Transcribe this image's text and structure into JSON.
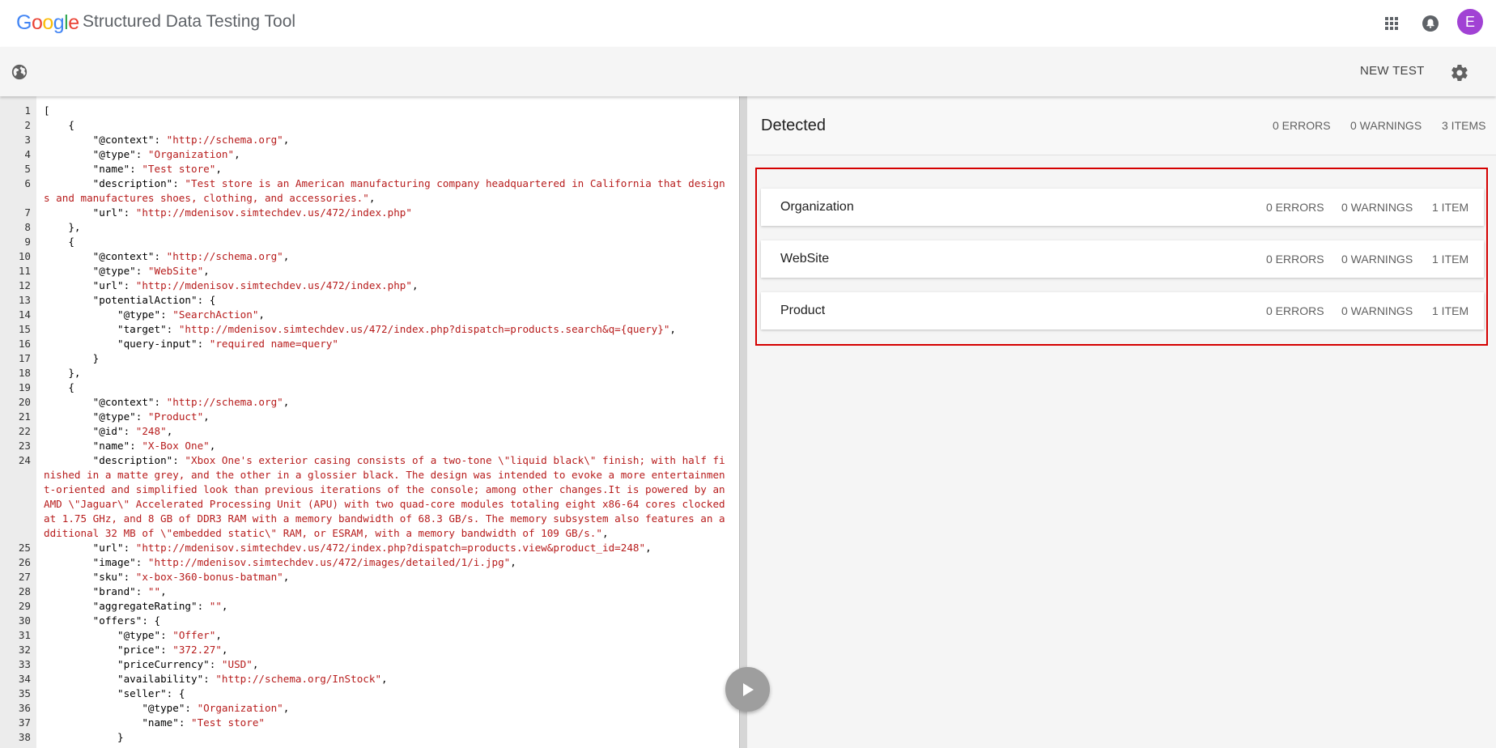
{
  "header": {
    "logo": [
      "G",
      "o",
      "o",
      "g",
      "l",
      "e"
    ],
    "logo_colors": [
      "#4285F4",
      "#EA4335",
      "#FBBC05",
      "#4285F4",
      "#34A853",
      "#EA4335"
    ],
    "app_title": "Structured Data Testing Tool",
    "avatar_letter": "E",
    "avatar_color": "#a142d4"
  },
  "toolbar": {
    "new_test_label": "NEW TEST"
  },
  "editor": {
    "lines": [
      {
        "n": "1",
        "t": [
          [
            "p",
            "["
          ]
        ]
      },
      {
        "n": "2",
        "t": [
          [
            "p",
            "    {"
          ]
        ]
      },
      {
        "n": "3",
        "t": [
          [
            "k",
            "        \"@context\""
          ],
          [
            "p",
            ": "
          ],
          [
            "s",
            "\"http://schema.org\""
          ],
          [
            "p",
            ","
          ]
        ]
      },
      {
        "n": "4",
        "t": [
          [
            "k",
            "        \"@type\""
          ],
          [
            "p",
            ": "
          ],
          [
            "s",
            "\"Organization\""
          ],
          [
            "p",
            ","
          ]
        ]
      },
      {
        "n": "5",
        "t": [
          [
            "k",
            "        \"name\""
          ],
          [
            "p",
            ": "
          ],
          [
            "s",
            "\"Test store\""
          ],
          [
            "p",
            ","
          ]
        ]
      },
      {
        "n": "6",
        "t": [
          [
            "k",
            "        \"description\""
          ],
          [
            "p",
            ": "
          ],
          [
            "s",
            "\"Test store is an American manufacturing company headquartered in California that designs and manufactures shoes, clothing, and accessories.\""
          ],
          [
            "p",
            ","
          ]
        ]
      },
      {
        "n": "7",
        "t": [
          [
            "k",
            "        \"url\""
          ],
          [
            "p",
            ": "
          ],
          [
            "s",
            "\"http://mdenisov.simtechdev.us/472/index.php\""
          ]
        ]
      },
      {
        "n": "8",
        "t": [
          [
            "p",
            "    },"
          ]
        ]
      },
      {
        "n": "9",
        "t": [
          [
            "p",
            "    {"
          ]
        ]
      },
      {
        "n": "10",
        "t": [
          [
            "k",
            "        \"@context\""
          ],
          [
            "p",
            ": "
          ],
          [
            "s",
            "\"http://schema.org\""
          ],
          [
            "p",
            ","
          ]
        ]
      },
      {
        "n": "11",
        "t": [
          [
            "k",
            "        \"@type\""
          ],
          [
            "p",
            ": "
          ],
          [
            "s",
            "\"WebSite\""
          ],
          [
            "p",
            ","
          ]
        ]
      },
      {
        "n": "12",
        "t": [
          [
            "k",
            "        \"url\""
          ],
          [
            "p",
            ": "
          ],
          [
            "s",
            "\"http://mdenisov.simtechdev.us/472/index.php\""
          ],
          [
            "p",
            ","
          ]
        ]
      },
      {
        "n": "13",
        "t": [
          [
            "k",
            "        \"potentialAction\""
          ],
          [
            "p",
            ": {"
          ]
        ]
      },
      {
        "n": "14",
        "t": [
          [
            "k",
            "            \"@type\""
          ],
          [
            "p",
            ": "
          ],
          [
            "s",
            "\"SearchAction\""
          ],
          [
            "p",
            ","
          ]
        ]
      },
      {
        "n": "15",
        "t": [
          [
            "k",
            "            \"target\""
          ],
          [
            "p",
            ": "
          ],
          [
            "s",
            "\"http://mdenisov.simtechdev.us/472/index.php?dispatch=products.search&q={query}\""
          ],
          [
            "p",
            ","
          ]
        ]
      },
      {
        "n": "16",
        "t": [
          [
            "k",
            "            \"query-input\""
          ],
          [
            "p",
            ": "
          ],
          [
            "s",
            "\"required name=query\""
          ]
        ]
      },
      {
        "n": "17",
        "t": [
          [
            "p",
            "        }"
          ]
        ]
      },
      {
        "n": "18",
        "t": [
          [
            "p",
            "    },"
          ]
        ]
      },
      {
        "n": "19",
        "t": [
          [
            "p",
            "    {"
          ]
        ]
      },
      {
        "n": "20",
        "t": [
          [
            "k",
            "        \"@context\""
          ],
          [
            "p",
            ": "
          ],
          [
            "s",
            "\"http://schema.org\""
          ],
          [
            "p",
            ","
          ]
        ]
      },
      {
        "n": "21",
        "t": [
          [
            "k",
            "        \"@type\""
          ],
          [
            "p",
            ": "
          ],
          [
            "s",
            "\"Product\""
          ],
          [
            "p",
            ","
          ]
        ]
      },
      {
        "n": "22",
        "t": [
          [
            "k",
            "        \"@id\""
          ],
          [
            "p",
            ": "
          ],
          [
            "s",
            "\"248\""
          ],
          [
            "p",
            ","
          ]
        ]
      },
      {
        "n": "23",
        "t": [
          [
            "k",
            "        \"name\""
          ],
          [
            "p",
            ": "
          ],
          [
            "s",
            "\"X-Box One\""
          ],
          [
            "p",
            ","
          ]
        ]
      },
      {
        "n": "24",
        "t": [
          [
            "k",
            "        \"description\""
          ],
          [
            "p",
            ": "
          ],
          [
            "s",
            "\"Xbox One's exterior casing consists of a two-tone \\\"liquid black\\\" finish; with half finished in a matte grey, and the other in a glossier black. The design was intended to evoke a more entertainment-oriented and simplified look than previous iterations of the console; among other changes.It is powered by an AMD \\\"Jaguar\\\" Accelerated Processing Unit (APU) with two quad-core modules totaling eight x86-64 cores clocked at 1.75 GHz, and 8 GB of DDR3 RAM with a memory bandwidth of 68.3 GB/s. The memory subsystem also features an additional 32 MB of \\\"embedded static\\\" RAM, or ESRAM, with a memory bandwidth of 109 GB/s.\""
          ],
          [
            "p",
            ","
          ]
        ]
      },
      {
        "n": "25",
        "t": [
          [
            "k",
            "        \"url\""
          ],
          [
            "p",
            ": "
          ],
          [
            "s",
            "\"http://mdenisov.simtechdev.us/472/index.php?dispatch=products.view&product_id=248\""
          ],
          [
            "p",
            ","
          ]
        ]
      },
      {
        "n": "26",
        "t": [
          [
            "k",
            "        \"image\""
          ],
          [
            "p",
            ": "
          ],
          [
            "s",
            "\"http://mdenisov.simtechdev.us/472/images/detailed/1/i.jpg\""
          ],
          [
            "p",
            ","
          ]
        ]
      },
      {
        "n": "27",
        "t": [
          [
            "k",
            "        \"sku\""
          ],
          [
            "p",
            ": "
          ],
          [
            "s",
            "\"x-box-360-bonus-batman\""
          ],
          [
            "p",
            ","
          ]
        ]
      },
      {
        "n": "28",
        "t": [
          [
            "k",
            "        \"brand\""
          ],
          [
            "p",
            ": "
          ],
          [
            "s",
            "\"\""
          ],
          [
            "p",
            ","
          ]
        ]
      },
      {
        "n": "29",
        "t": [
          [
            "k",
            "        \"aggregateRating\""
          ],
          [
            "p",
            ": "
          ],
          [
            "s",
            "\"\""
          ],
          [
            "p",
            ","
          ]
        ]
      },
      {
        "n": "30",
        "t": [
          [
            "k",
            "        \"offers\""
          ],
          [
            "p",
            ": {"
          ]
        ]
      },
      {
        "n": "31",
        "t": [
          [
            "k",
            "            \"@type\""
          ],
          [
            "p",
            ": "
          ],
          [
            "s",
            "\"Offer\""
          ],
          [
            "p",
            ","
          ]
        ]
      },
      {
        "n": "32",
        "t": [
          [
            "k",
            "            \"price\""
          ],
          [
            "p",
            ": "
          ],
          [
            "s",
            "\"372.27\""
          ],
          [
            "p",
            ","
          ]
        ]
      },
      {
        "n": "33",
        "t": [
          [
            "k",
            "            \"priceCurrency\""
          ],
          [
            "p",
            ": "
          ],
          [
            "s",
            "\"USD\""
          ],
          [
            "p",
            ","
          ]
        ]
      },
      {
        "n": "34",
        "t": [
          [
            "k",
            "            \"availability\""
          ],
          [
            "p",
            ": "
          ],
          [
            "s",
            "\"http://schema.org/InStock\""
          ],
          [
            "p",
            ","
          ]
        ]
      },
      {
        "n": "35",
        "t": [
          [
            "k",
            "            \"seller\""
          ],
          [
            "p",
            ": {"
          ]
        ]
      },
      {
        "n": "36",
        "t": [
          [
            "k",
            "                \"@type\""
          ],
          [
            "p",
            ": "
          ],
          [
            "s",
            "\"Organization\""
          ],
          [
            "p",
            ","
          ]
        ]
      },
      {
        "n": "37",
        "t": [
          [
            "k",
            "                \"name\""
          ],
          [
            "p",
            ": "
          ],
          [
            "s",
            "\"Test store\""
          ]
        ]
      },
      {
        "n": "38",
        "t": [
          [
            "p",
            "            }"
          ]
        ]
      }
    ]
  },
  "results": {
    "title": "Detected",
    "errors": "0 ERRORS",
    "warnings": "0 WARNINGS",
    "items": "3 ITEMS",
    "highlight_color": "#d50000",
    "cards": [
      {
        "name": "Organization",
        "errors": "0 ERRORS",
        "warnings": "0 WARNINGS",
        "items": "1 ITEM"
      },
      {
        "name": "WebSite",
        "errors": "0 ERRORS",
        "warnings": "0 WARNINGS",
        "items": "1 ITEM"
      },
      {
        "name": "Product",
        "errors": "0 ERRORS",
        "warnings": "0 WARNINGS",
        "items": "1 ITEM"
      }
    ]
  }
}
